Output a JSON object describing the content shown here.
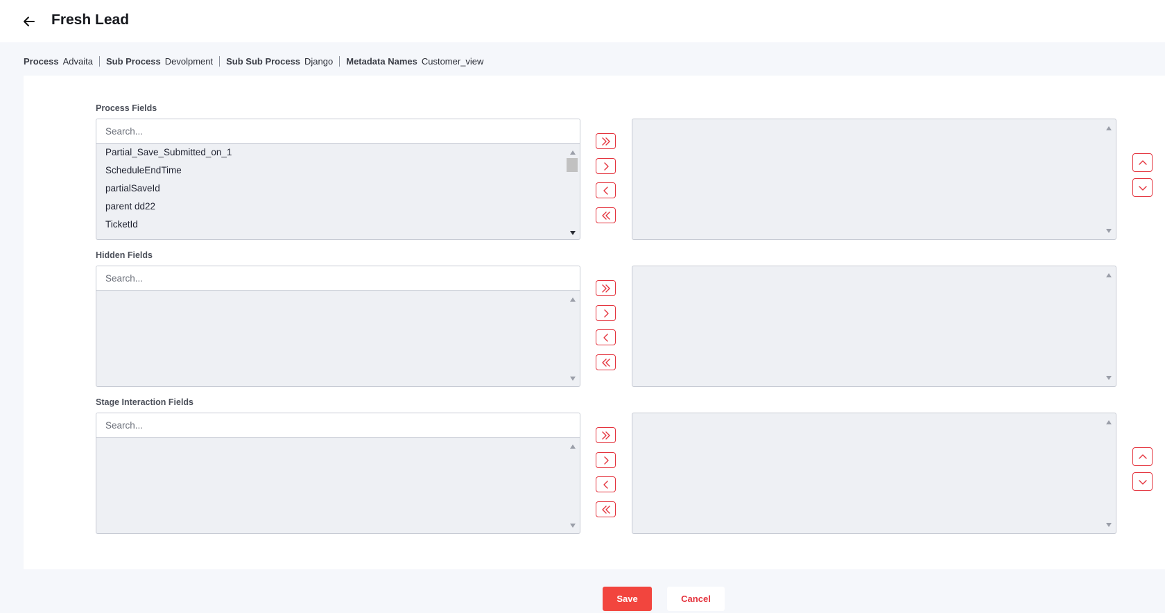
{
  "header": {
    "title": "Fresh Lead",
    "back_icon": "arrow-left-icon"
  },
  "breadcrumb": [
    {
      "label": "Process",
      "value": "Advaita"
    },
    {
      "label": "Sub Process",
      "value": "Devolpment"
    },
    {
      "label": "Sub Sub Process",
      "value": "Django"
    },
    {
      "label": "Metadata Names",
      "value": "Customer_view"
    }
  ],
  "sections": {
    "process": {
      "label": "Process Fields",
      "search_placeholder": "Search...",
      "items": [
        "Partial_Save_Submitted_on_1",
        "ScheduleEndTime",
        "partialSaveId",
        "parent dd22",
        "TicketId"
      ]
    },
    "hidden": {
      "label": "Hidden Fields",
      "search_placeholder": "Search...",
      "items": []
    },
    "stage": {
      "label": "Stage Interaction Fields",
      "search_placeholder": "Search...",
      "items": []
    }
  },
  "transfer_icons": [
    "move-all-right-icon",
    "move-right-icon",
    "move-left-icon",
    "move-all-left-icon"
  ],
  "order_icons": [
    "move-up-icon",
    "move-down-icon"
  ],
  "actions": {
    "save_label": "Save",
    "cancel_label": "Cancel"
  },
  "colors": {
    "accent": "#e4333d",
    "save_bg": "#f2453e",
    "list_bg": "#eef0f4"
  }
}
